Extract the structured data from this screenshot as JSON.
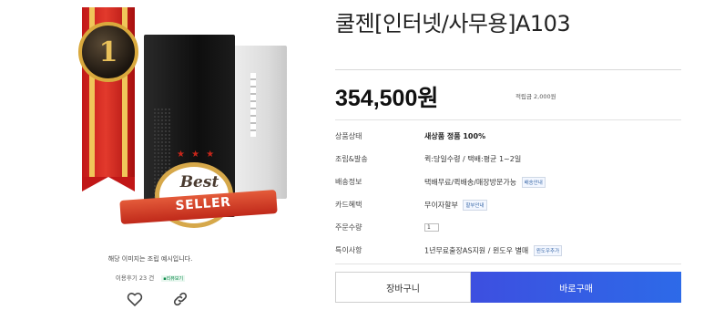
{
  "product": {
    "title": "쿨젠[인터넷/사무용]A103",
    "price": "354,500원",
    "points": "적립금 2,000원"
  },
  "image": {
    "medal_number": "1",
    "badge_best": "Best",
    "badge_seller": "SELLER",
    "caption": "해당 이미지는 조립 예시입니다.",
    "reviews": "이용후기 23 건",
    "reviews_badge": "▪리뷰보기"
  },
  "details": [
    {
      "label": "상품상태",
      "value": "새상품 정품 100%",
      "bold": true
    },
    {
      "label": "조립&발송",
      "value": "퀵:당일수령 / 택배:평균 1~2일"
    },
    {
      "label": "배송정보",
      "value": "택배무료/퀵배송/매장방문가능",
      "tag": "배송안내"
    },
    {
      "label": "카드혜택",
      "value": "무이자할부",
      "tag": "할부안내"
    },
    {
      "label": "주문수량",
      "qty": "1"
    },
    {
      "label": "특이사항",
      "value": "1년무료출장AS지원 / 윈도우 별매",
      "tag": "윈도우추가"
    }
  ],
  "buttons": {
    "cart": "장바구니",
    "buy": "바로구매"
  },
  "colors": {
    "buy_button": "#2d5ee6",
    "ribbon": "#c11717",
    "medal_gold": "#d9a93d"
  },
  "icons": [
    "heart-icon",
    "link-icon"
  ]
}
